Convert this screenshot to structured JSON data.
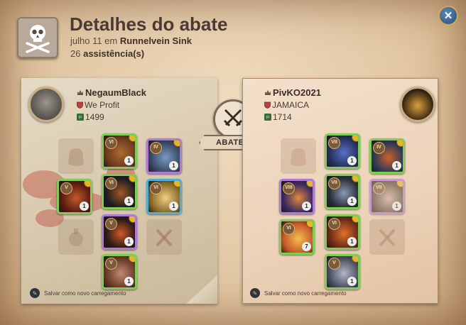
{
  "header": {
    "title": "Detalhes do abate",
    "date_prefix": "julho 11 em",
    "location": "Runnelvein Sink",
    "assist_count": "26",
    "assist_label": "assistência(s)"
  },
  "center": {
    "ribbon_label": "ABATEU"
  },
  "killer": {
    "name": "NegaumBlack",
    "guild": "We Profit",
    "ip": "1499",
    "save_label": "Salvar como novo carregamento",
    "items": [
      {
        "slot": "head",
        "tier": "VI",
        "qty": "1",
        "rarity": "green",
        "colors": [
          "#6b3a1e",
          "#b06a30"
        ]
      },
      {
        "slot": "cape",
        "tier": "IV",
        "qty": "1",
        "rarity": "purple",
        "colors": [
          "#394a66",
          "#7a9ac0"
        ]
      },
      {
        "slot": "mainhand",
        "tier": "V",
        "qty": "1",
        "rarity": "green",
        "colors": [
          "#5a1a12",
          "#c25a2a"
        ]
      },
      {
        "slot": "armor",
        "tier": "VI",
        "qty": "1",
        "rarity": "green",
        "colors": [
          "#1e1c22",
          "#a05a25"
        ]
      },
      {
        "slot": "offhand",
        "tier": "VI",
        "qty": "1",
        "rarity": "blue",
        "colors": [
          "#8a6a2a",
          "#f0d080"
        ]
      },
      {
        "slot": "shoes",
        "tier": "V",
        "qty": "1",
        "rarity": "purple",
        "colors": [
          "#2a1a16",
          "#d05a2a"
        ]
      },
      {
        "slot": "mount",
        "tier": "V",
        "qty": "1",
        "rarity": "green",
        "colors": [
          "#6a3a2a",
          "#c08a70"
        ]
      }
    ]
  },
  "victim": {
    "name": "PivKO2021",
    "guild": "JAMAICA",
    "ip": "1714",
    "save_label": "Salvar como novo carregamento",
    "items": [
      {
        "slot": "head",
        "tier": "VII",
        "qty": "1",
        "rarity": "green",
        "colors": [
          "#25305a",
          "#5a70c8"
        ]
      },
      {
        "slot": "cape",
        "tier": "IV",
        "qty": "1",
        "rarity": "green",
        "colors": [
          "#2e3a54",
          "#d0622a"
        ]
      },
      {
        "slot": "mainhand",
        "tier": "VIII",
        "qty": "1",
        "rarity": "purple",
        "colors": [
          "#3a2a60",
          "#e08a3a"
        ]
      },
      {
        "slot": "armor",
        "tier": "VII",
        "qty": "1",
        "rarity": "green",
        "colors": [
          "#2a2e3a",
          "#8a98b0"
        ]
      },
      {
        "slot": "offhand",
        "tier": "VII",
        "qty": "1",
        "rarity": "purple",
        "colors": [
          "#5a4a40",
          "#d0b0a0"
        ]
      },
      {
        "slot": "potion",
        "tier": "VI",
        "qty": "7",
        "rarity": "green",
        "colors": [
          "#c85a2a",
          "#f0c050"
        ]
      },
      {
        "slot": "shoes",
        "tier": "VI",
        "qty": "1",
        "rarity": "green",
        "colors": [
          "#6a2a1a",
          "#e0702a"
        ]
      },
      {
        "slot": "mount",
        "tier": "V",
        "qty": "1",
        "rarity": "green",
        "colors": [
          "#4a5060",
          "#b0b8c8"
        ]
      }
    ]
  }
}
